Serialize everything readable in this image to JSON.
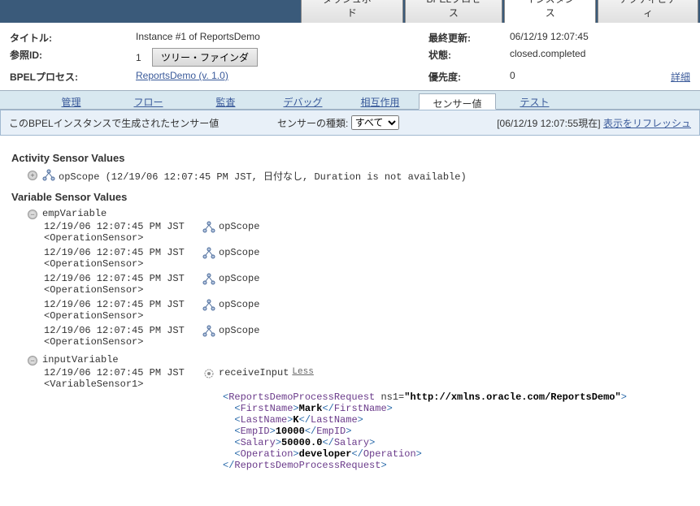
{
  "topTabs": {
    "dashboard": "ダッシュボード",
    "bpel": "BPELプロセス",
    "instances": "インスタンス",
    "activity": "アクティビティ"
  },
  "header": {
    "titleLabel": "タイトル:",
    "titleValue": "Instance #1 of ReportsDemo",
    "lastUpdateLabel": "最終更新:",
    "lastUpdateValue": "06/12/19 12:07:45",
    "refIdLabel": "参照ID:",
    "refIdValue": "1",
    "treeFinder": "ツリー・ファインダ",
    "stateLabel": "状態:",
    "stateValue": "closed.completed",
    "bpelLabel": "BPELプロセス:",
    "bpelLink": "ReportsDemo (v. 1.0)",
    "priorityLabel": "優先度:",
    "priorityValue": "0",
    "detail": "詳細"
  },
  "subTabs": {
    "manage": "管理",
    "flow": "フロー",
    "audit": "監査",
    "debug": "デバッグ",
    "interaction": "相互作用",
    "sensor": "センサー値",
    "test": "テスト"
  },
  "infobar": {
    "desc": "このBPELインスタンスで生成されたセンサー値",
    "typeLabel": "センサーの種類:",
    "selectValue": "すべて",
    "timestamp": "[06/12/19 12:07:55現在]",
    "refresh": "表示をリフレッシュ"
  },
  "activity": {
    "heading": "Activity Sensor Values",
    "line": "opScope (12/19/06 12:07:45 PM JST, 日付なし, Duration is not available)"
  },
  "variable": {
    "heading": "Variable Sensor Values",
    "empVar": "empVariable",
    "inputVar": "inputVariable",
    "rows": [
      {
        "ts": "12/19/06 12:07:45 PM JST",
        "sensor": "<OperationSensor>",
        "scope": "opScope"
      },
      {
        "ts": "12/19/06 12:07:45 PM JST",
        "sensor": "<OperationSensor>",
        "scope": "opScope"
      },
      {
        "ts": "12/19/06 12:07:45 PM JST",
        "sensor": "<OperationSensor>",
        "scope": "opScope"
      },
      {
        "ts": "12/19/06 12:07:45 PM JST",
        "sensor": "<OperationSensor>",
        "scope": "opScope"
      },
      {
        "ts": "12/19/06 12:07:45 PM JST",
        "sensor": "<OperationSensor>",
        "scope": "opScope"
      }
    ],
    "input": {
      "ts": "12/19/06 12:07:45 PM JST",
      "sensor": "<VariableSensor1>",
      "recv": "receiveInput",
      "less": "Less"
    },
    "xml": {
      "root": "ReportsDemoProcessRequest",
      "ns": "ns1=",
      "nsurl": "\"http://xmlns.oracle.com/ReportsDemo\"",
      "firstNameTag": "FirstName",
      "firstName": "Mark",
      "lastNameTag": "LastName",
      "lastName": "K",
      "empIdTag": "EmpID",
      "empId": "10000",
      "salaryTag": "Salary",
      "salary": "50000.0",
      "operationTag": "Operation",
      "operation": "developer"
    }
  }
}
